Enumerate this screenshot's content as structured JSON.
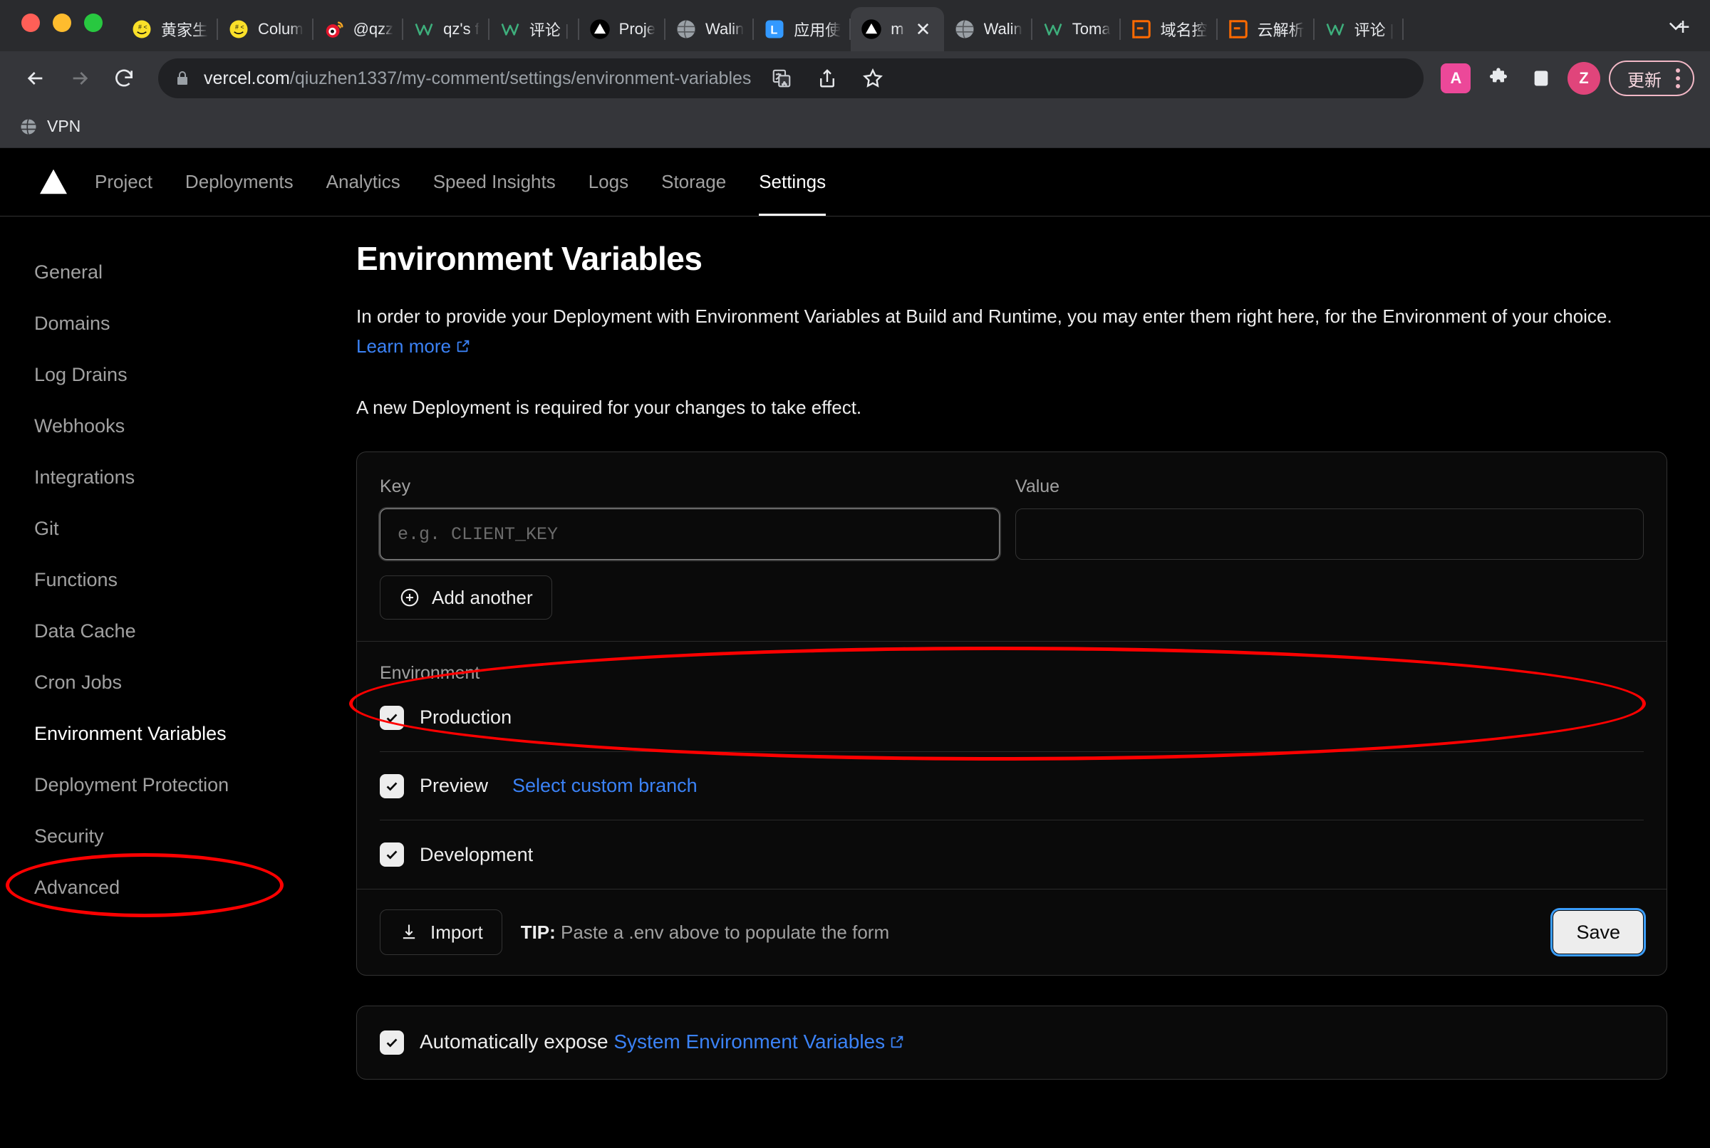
{
  "browser": {
    "tabs": [
      {
        "title": "黄家生",
        "icon": "smiley-icon",
        "active": false
      },
      {
        "title": "Colum",
        "icon": "smiley-icon",
        "active": false
      },
      {
        "title": "@qzz",
        "icon": "weibo-icon",
        "active": false
      },
      {
        "title": "qz's f",
        "icon": "waline-icon",
        "active": false
      },
      {
        "title": "评论 |",
        "icon": "waline-icon",
        "active": false
      },
      {
        "title": "Proje",
        "icon": "vercel-icon",
        "active": false
      },
      {
        "title": "Walin",
        "icon": "globe-icon",
        "active": false
      },
      {
        "title": "应用使",
        "icon": "leancloud-icon",
        "active": false
      },
      {
        "title": "m",
        "icon": "vercel-icon",
        "active": true
      },
      {
        "title": "Walin",
        "icon": "globe-icon",
        "active": false
      },
      {
        "title": "Toma",
        "icon": "waline-icon",
        "active": false
      },
      {
        "title": "域名控",
        "icon": "dnspod-icon",
        "active": false
      },
      {
        "title": "云解析",
        "icon": "dnspod-icon",
        "active": false
      },
      {
        "title": "评论 |",
        "icon": "waline-icon",
        "active": false
      }
    ],
    "new_tab_label": "+",
    "toolbar": {
      "back": "back-arrow",
      "forward": "forward-arrow",
      "reload": "reload",
      "url_host": "vercel.com",
      "url_path": "/qiuzhen1337/my-comment/settings/environment-variables",
      "translate_icon": "translate-icon",
      "share_icon": "share-icon",
      "bookmark_icon": "star-icon",
      "extension_badge": "A",
      "puzzle_icon": "extensions-icon",
      "sidepanel_icon": "side-panel-icon",
      "profile_initial": "Z",
      "update_label": "更新"
    },
    "bookmarks": [
      {
        "label": "VPN",
        "icon": "globe-icon"
      }
    ]
  },
  "vercel": {
    "nav": [
      {
        "label": "Project",
        "active": false
      },
      {
        "label": "Deployments",
        "active": false
      },
      {
        "label": "Analytics",
        "active": false
      },
      {
        "label": "Speed Insights",
        "active": false
      },
      {
        "label": "Logs",
        "active": false
      },
      {
        "label": "Storage",
        "active": false
      },
      {
        "label": "Settings",
        "active": true
      }
    ],
    "sidebar": [
      {
        "label": "General",
        "active": false
      },
      {
        "label": "Domains",
        "active": false
      },
      {
        "label": "Log Drains",
        "active": false
      },
      {
        "label": "Webhooks",
        "active": false
      },
      {
        "label": "Integrations",
        "active": false
      },
      {
        "label": "Git",
        "active": false
      },
      {
        "label": "Functions",
        "active": false
      },
      {
        "label": "Data Cache",
        "active": false
      },
      {
        "label": "Cron Jobs",
        "active": false
      },
      {
        "label": "Environment Variables",
        "active": true
      },
      {
        "label": "Deployment Protection",
        "active": false
      },
      {
        "label": "Security",
        "active": false
      },
      {
        "label": "Advanced",
        "active": false
      }
    ],
    "page_title": "Environment Variables",
    "description_part1": "In order to provide your Deployment with Environment Variables at Build and Runtime, you may enter them right here, for the Environment of your choice. ",
    "learn_more_label": "Learn more",
    "description_part2": "A new Deployment is required for your changes to take effect.",
    "form": {
      "key_label": "Key",
      "key_value": "",
      "key_placeholder": "e.g. CLIENT_KEY",
      "value_label": "Value",
      "value_value": "",
      "value_placeholder": "",
      "add_another_label": "Add another",
      "environment_title": "Environment",
      "environments": [
        {
          "label": "Production",
          "checked": true,
          "link": ""
        },
        {
          "label": "Preview",
          "checked": true,
          "link": "Select custom branch"
        },
        {
          "label": "Development",
          "checked": true,
          "link": ""
        }
      ],
      "import_label": "Import",
      "tip_prefix": "TIP:",
      "tip_text": " Paste a .env above to populate the form",
      "save_label": "Save"
    },
    "system_env": {
      "checked": true,
      "text": "Automatically expose ",
      "link_label": "System Environment Variables"
    },
    "colors": {
      "accent_link": "#3b82f6",
      "focus_ring": "#3b9dfb",
      "annotation": "#ff0000",
      "background": "#000000",
      "card": "#0a0a0a",
      "border": "#333333"
    }
  }
}
